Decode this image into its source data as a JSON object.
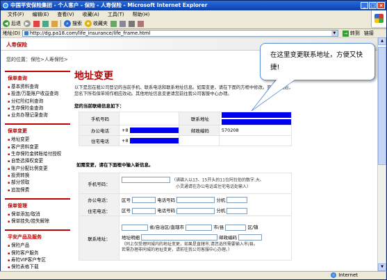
{
  "window": {
    "title": "中国平安保险集团 - 个人客户 - 保险 - 人寿保险 - Microsoft Internet Explorer"
  },
  "menu": [
    "文件(F)",
    "编辑(E)",
    "查看(V)",
    "收藏(A)",
    "工具(T)",
    "帮助(H)"
  ],
  "toolbar": {
    "back": "后退",
    "search": "搜索",
    "favorites": "收藏夹"
  },
  "address": {
    "label": "地址(D)",
    "url": "http://dg.pa18.com/life_insurance/life_frame.html",
    "go": "转到",
    "links": "链接"
  },
  "status": {
    "text": "",
    "zone": "Internet"
  },
  "page": {
    "brand": "人寿保险",
    "breadcrumb": "您的位置：保险>人寿保险>",
    "title": "地址变更",
    "intro": "以下是您在我公司登记的当前手机、联系电话和联系地址信息。如需变更，请在下面的方框中修改。变更完成后，您名下所有保单将作相应改动。其他地址信息变更请您前往我公司客服中心办理。",
    "current_label": "您的当前联络信息如下：",
    "change_label": "如需变更，请在下面框中输入新信息。"
  },
  "sidebar": {
    "sections": [
      {
        "head": "保单查询",
        "items": [
          "基本资料查询",
          "投连/万能账户收益查询",
          "分红险红利查询",
          "生存保险金查询",
          "业务办理记录查询"
        ]
      },
      {
        "head": "保单变更",
        "items": [
          "地址变更",
          "客户资料变更",
          "生存保险金转账给付授权",
          "自垫选择权变更",
          "账户分配比例变更",
          "投资转换",
          "部分领取",
          "追加保费"
        ]
      },
      {
        "head": "保单管理",
        "items": [
          "保单添加/取消",
          "保单挂失/挂失解除"
        ]
      },
      {
        "head": "平安产品及服务",
        "items": [
          "保险产品",
          "保险客户服务",
          "寿险VIP客户专区",
          "保险表格下载"
        ]
      }
    ]
  },
  "info_table": {
    "mobile_label": "手机号码",
    "mobile_value": "",
    "contact_addr_label": "联系地址",
    "office_label": "办公电话",
    "office_value": "+8",
    "postcode_label": "邮政编码",
    "postcode_value": "570208",
    "home_label": "住宅电话",
    "home_value": "+8"
  },
  "form": {
    "mobile_label": "手机号码：",
    "mobile_note1": "（请输入以13、15开头的11位阿拉伯的数字,大、",
    "mobile_note2": "小灵通请在办公电话或住宅电话处输入）",
    "office_label": "办公电话：",
    "home_label": "住宅电话：",
    "area_code": "区号",
    "phone_no": "电话号码",
    "ext": "分机",
    "addr_label": "联系地址：",
    "province": "省/自治区/直辖市",
    "city": "市/县",
    "district": "区/镇",
    "addr_detail": "地址明细",
    "postcode": "邮政编码",
    "addr_note": "（同上仅受理同城内的地址变更，如果是直辖市,请忽选所需要输入市/县。若需办理非同城的地址变更，请前往我公司客服中心办理。）"
  },
  "callout": {
    "text": "在这里变更联系地址，方便又快捷!"
  }
}
